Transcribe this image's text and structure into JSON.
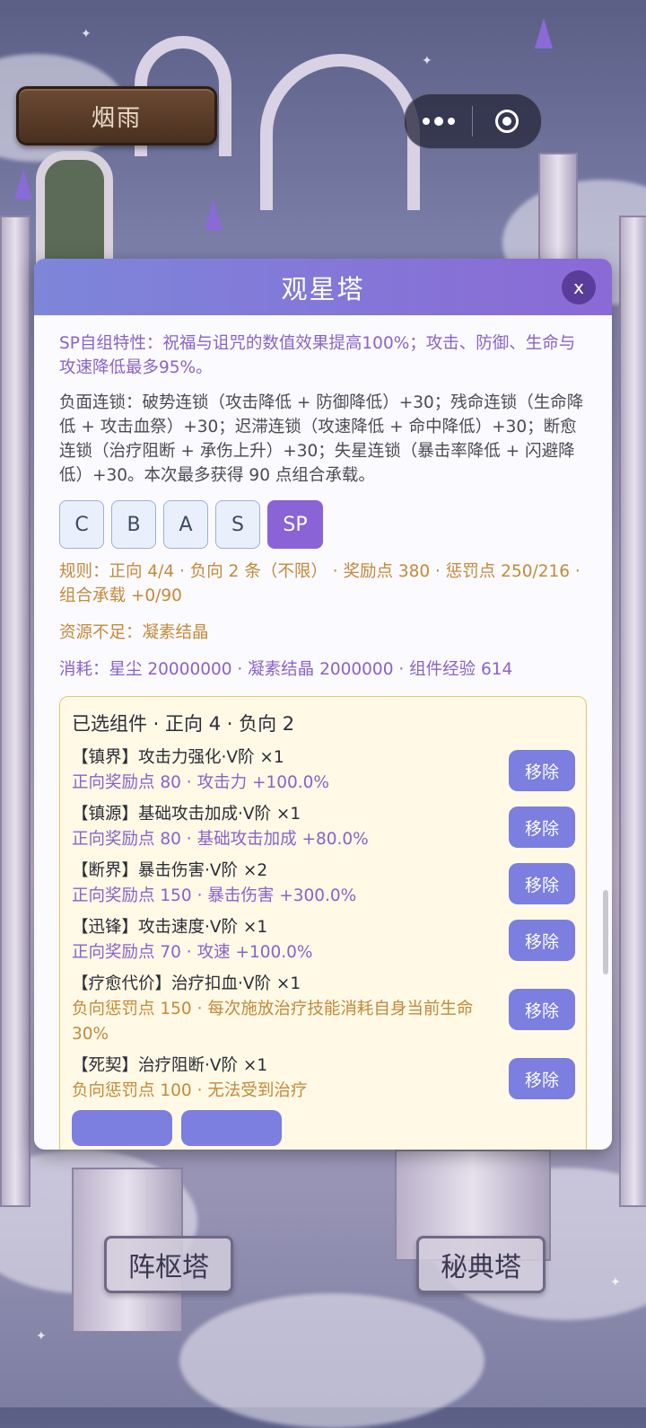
{
  "header": {
    "player_name": "烟雨"
  },
  "modal": {
    "title": "观星塔",
    "close_label": "x",
    "sp_trait": "SP自组特性：祝福与诅咒的数值效果提高100%；攻击、防御、生命与攻速降低最多95%。",
    "negative_chain": "负面连锁：破势连锁（攻击降低 + 防御降低）+30；残命连锁（生命降低 + 攻击血祭）+30；迟滞连锁（攻速降低 + 命中降低）+30；断愈连锁（治疗阻断 + 承伤上升）+30；失星连锁（暴击率降低 + 闪避降低）+30。本次最多获得 90 点组合承载。",
    "tiers": [
      "C",
      "B",
      "A",
      "S",
      "SP"
    ],
    "active_tier": "SP",
    "rule_text": "规则：正向 4/4 · 负向 2 条（不限） · 奖励点 380 · 惩罚点 250/216 · 组合承载 +0/90",
    "shortage_text": "资源不足：凝素结晶",
    "cost_text": "消耗：星尘 20000000 · 凝素结晶 2000000 · 组件经验 614",
    "selected": {
      "heading": "已选组件 · 正向 4 · 负向 2",
      "remove_label": "移除",
      "items": [
        {
          "name": "【镇界】攻击力强化·V阶 ×1",
          "detail": "正向奖励点 80 · 攻击力 +100.0%",
          "kind": "positive"
        },
        {
          "name": "【镇源】基础攻击加成·V阶 ×1",
          "detail": "正向奖励点 80 · 基础攻击加成 +80.0%",
          "kind": "positive"
        },
        {
          "name": "【断界】暴击伤害·V阶 ×2",
          "detail": "正向奖励点 150 · 暴击伤害 +300.0%",
          "kind": "positive"
        },
        {
          "name": "【迅锋】攻击速度·V阶 ×1",
          "detail": "正向奖励点 70 · 攻速 +100.0%",
          "kind": "positive"
        },
        {
          "name": "【疗愈代价】治疗扣血·V阶 ×1",
          "detail": "负向惩罚点 150 · 每次施放治疗技能消耗自身当前生命 30%",
          "kind": "negative"
        },
        {
          "name": "【死契】治疗阻断·V阶 ×1",
          "detail": "负向惩罚点 100 · 无法受到治疗",
          "kind": "negative"
        }
      ]
    }
  },
  "towers": {
    "left": "阵枢塔",
    "right": "秘典塔"
  },
  "colors": {
    "accent": "#8a63d6",
    "header_gradient_start": "#7d86d9",
    "header_gradient_end": "#8a6ad6",
    "positive_text": "#8a63c9",
    "negative_text": "#c48a3a",
    "selected_bg": "#fff9e6"
  }
}
